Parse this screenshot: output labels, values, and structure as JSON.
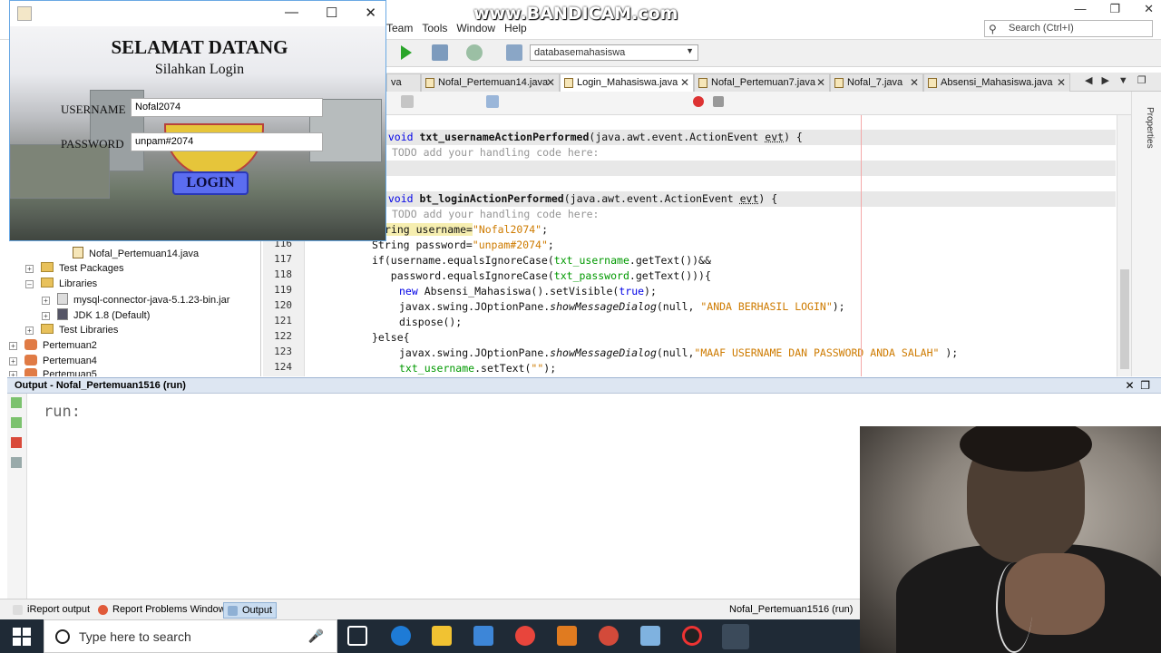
{
  "watermark": "www.BANDICAM.com",
  "ide": {
    "menu": [
      "Team",
      "Tools",
      "Window",
      "Help"
    ],
    "search_placeholder": "Search (Ctrl+I)",
    "db_selector": "databasemahasiswa",
    "tabs": [
      {
        "label": "va",
        "active": false
      },
      {
        "label": "Nofal_Pertemuan14.java",
        "active": false
      },
      {
        "label": "Login_Mahasiswa.java",
        "active": true
      },
      {
        "label": "Nofal_Pertemuan7.java",
        "active": false
      },
      {
        "label": "Nofal_7.java",
        "active": false
      },
      {
        "label": "Absensi_Mahasiswa.java",
        "active": false
      }
    ],
    "properties_label": "Properties"
  },
  "tree": {
    "items": [
      {
        "label": "Nofal_Pertemuan14.java"
      },
      {
        "label": "Test Packages"
      },
      {
        "label": "Libraries"
      },
      {
        "label": "mysql-connector-java-5.1.23-bin.jar"
      },
      {
        "label": "JDK 1.8 (Default)"
      },
      {
        "label": "Test Libraries"
      },
      {
        "label": "Pertemuan2"
      },
      {
        "label": "Pertemuan4"
      },
      {
        "label": "Pertemuan5"
      }
    ]
  },
  "code": {
    "line_numbers": [
      "116",
      "117",
      "118",
      "119",
      "120",
      "121",
      "122",
      "123",
      "124"
    ],
    "lines": [
      {
        "a": "e void ",
        "b": "txt_usernameActionPerformed",
        "c": "(java.awt.event.ActionEvent ",
        "d": "evt",
        "e": ") {"
      },
      {
        "comment": "TODO add your handling code here:"
      },
      {
        "a": "e void ",
        "b": "bt_loginActionPerformed",
        "c": "(java.awt.event.ActionEvent ",
        "d": "evt",
        "e": ") {"
      },
      {
        "comment": "TODO add your handling code here:"
      },
      {
        "pre": "ring username=",
        "str": "\"Nofal2074\"",
        "post": ";"
      },
      {
        "pre": "String password=",
        "str": "\"unpam#2074\"",
        "post": ";"
      },
      {
        "pre": "if(username.equalsIgnoreCase(",
        "fld": "txt_username",
        "post": ".getText())&&"
      },
      {
        "pre": "   password.equalsIgnoreCase(",
        "fld": "txt_password",
        "post": ".getText())){"
      },
      {
        "kw": "new",
        "post": " Absensi_Mahasiswa().setVisible(",
        "kw2": "true",
        "post2": ");"
      },
      {
        "pre": "javax.swing.JOptionPane.",
        "it": "showMessageDialog",
        "mid": "(null, ",
        "str": "\"ANDA BERHASIL LOGIN\"",
        "post": ");"
      },
      {
        "pre": "dispose();"
      },
      {
        "kw": "}else{"
      },
      {
        "pre": "javax.swing.JOptionPane.",
        "it": "showMessageDialog",
        "mid": "(null,",
        "str": "\"MAAF USERNAME DAN PASSWORD ANDA SALAH\"",
        "post": " );"
      },
      {
        "fld": "txt_username",
        "post": ".setText(",
        "str": "\"\"",
        "post2": ");"
      }
    ]
  },
  "output": {
    "title": "Output - Nofal_Pertemuan1516 (run)",
    "text": "run:"
  },
  "statusbar": {
    "tabs": [
      "iReport output",
      "Report Problems Window",
      "Output"
    ],
    "running": "Nofal_Pertemuan1516 (run)"
  },
  "taskbar": {
    "search_placeholder": "Type here to search"
  },
  "login": {
    "heading": "SELAMAT DATANG",
    "subheading": "Silahkan Login",
    "username_label": "USERNAME",
    "password_label": "PASSWORD",
    "username_value": "Nofal2074",
    "password_value": "unpam#2074",
    "button": "LOGIN"
  }
}
